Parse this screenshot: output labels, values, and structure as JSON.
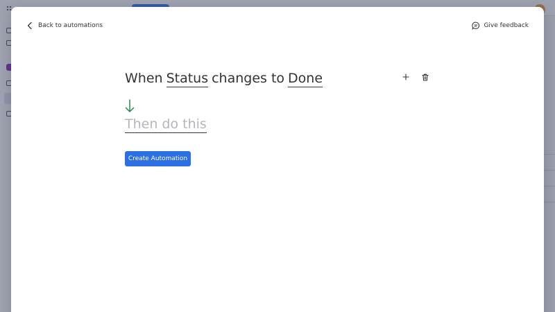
{
  "header": {
    "back_label": "Back to automations",
    "feedback_label": "Give feedback"
  },
  "recipe": {
    "trigger": {
      "prefix": "When",
      "column_token": "Status",
      "middle": "changes to",
      "value_token": "Done"
    },
    "action_placeholder": "Then do this"
  },
  "footer": {
    "create_label": "Create Automation"
  },
  "icons": {
    "back": "chevron-left-icon",
    "feedback": "chat-bubble-icon",
    "add": "plus-icon",
    "delete": "trash-icon",
    "flow": "arrow-down-icon"
  },
  "colors": {
    "primary": "#2b6fe2",
    "flow_arrow": "#258750",
    "text": "#323338",
    "placeholder": "#b5b6bc"
  }
}
